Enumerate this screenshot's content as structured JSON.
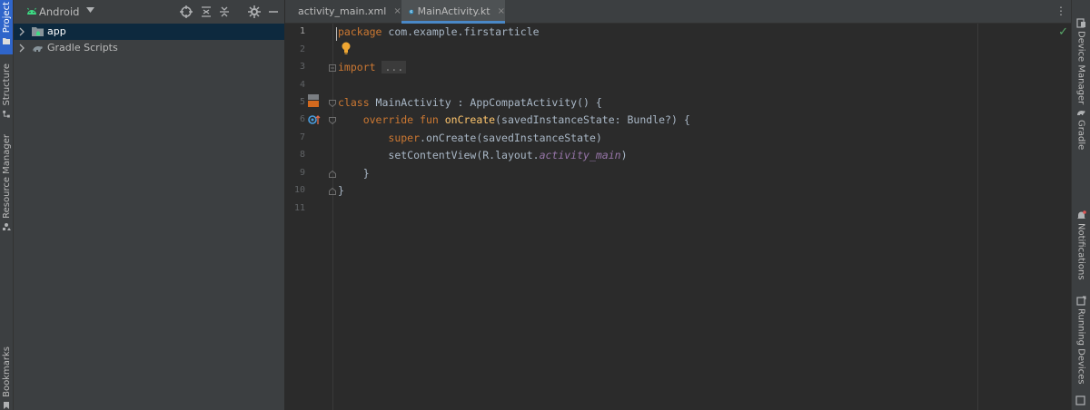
{
  "left_toolbar": {
    "project": "Project",
    "structure": "Structure",
    "resource_manager": "Resource Manager",
    "bookmarks": "Bookmarks"
  },
  "project_panel": {
    "view_selector": "Android",
    "tree": [
      {
        "label": "app",
        "icon": "app-module-icon",
        "selected": true
      },
      {
        "label": "Gradle Scripts",
        "icon": "gradle-icon",
        "selected": false
      }
    ],
    "header_icons": [
      "select-opened-file-icon",
      "expand-all-icon",
      "collapse-all-icon",
      "gear-icon",
      "hide-icon"
    ]
  },
  "tabs": [
    {
      "label": "activity_main.xml",
      "close": "×",
      "active": false,
      "icon": "xml-layout-icon"
    },
    {
      "label": "MainActivity.kt",
      "close": "×",
      "active": true,
      "icon": "kotlin-class-icon"
    }
  ],
  "tabs_menu": "⋮",
  "editor": {
    "line_numbers": [
      "1",
      "2",
      "3",
      "4",
      "5",
      "6",
      "7",
      "8",
      "9",
      "10",
      "11"
    ],
    "code": {
      "l1_kw": "package",
      "l1_rest": " com.example.firstarticle",
      "l3_kw": "import",
      "l3_collapsed": "...",
      "l6_kw": "class",
      "l6_rest": " MainActivity : AppCompatActivity() {",
      "l7_indent": "    ",
      "l7_kw": "override fun",
      "l7_fn": " onCreate",
      "l7_rest": "(savedInstanceState: Bundle?) {",
      "l8_indent": "        ",
      "l8_kw": "super",
      "l8_rest": ".onCreate(savedInstanceState)",
      "l9_indent": "        ",
      "l9_rest": "setContentView(R.layout.",
      "l9_it": "activity_main",
      "l9_close": ")",
      "l10": "    }",
      "l11": "}"
    },
    "inspection_status": "✓"
  },
  "right_toolbar": {
    "device_manager": "Device Manager",
    "gradle": "Gradle",
    "notifications": "Notifications",
    "running_devices": "Running Devices"
  },
  "colors": {
    "keyword": "#cc7832",
    "function": "#ffc66d",
    "field": "#9876aa",
    "text": "#a9b7c6",
    "selection": "#0d293e",
    "accent": "#4a88c7"
  }
}
